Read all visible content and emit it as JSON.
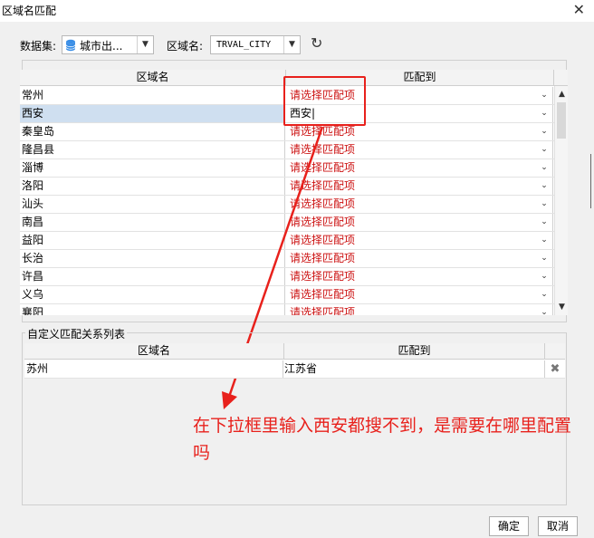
{
  "window": {
    "title": "区域名匹配",
    "close_glyph": "✕"
  },
  "toolbar": {
    "dataset_label": "数据集:",
    "dataset_value": "城市出...",
    "region_label": "区域名:",
    "region_value": "TRVAL_CITY",
    "refresh_glyph": "↻"
  },
  "grid": {
    "headers": [
      "区域名",
      "匹配到"
    ],
    "rows": [
      {
        "name": "常州",
        "match": "请选择匹配项"
      },
      {
        "name": "西安",
        "match": "西安|"
      },
      {
        "name": "秦皇岛",
        "match": "请选择匹配项"
      },
      {
        "name": "隆昌县",
        "match": "请选择匹配项"
      },
      {
        "name": "淄博",
        "match": "请选择匹配项"
      },
      {
        "name": "洛阳",
        "match": "请选择匹配项"
      },
      {
        "name": "汕头",
        "match": "请选择匹配项"
      },
      {
        "name": "南昌",
        "match": "请选择匹配项"
      },
      {
        "name": "益阳",
        "match": "请选择匹配项"
      },
      {
        "name": "长治",
        "match": "请选择匹配项"
      },
      {
        "name": "许昌",
        "match": "请选择匹配项"
      },
      {
        "name": "义乌",
        "match": "请选择匹配项"
      },
      {
        "name": "襄阳",
        "match": "请选择匹配项"
      }
    ],
    "selected_row": 1,
    "dropdown_glyph": "⌄"
  },
  "custom": {
    "label": "自定义匹配关系列表",
    "headers": [
      "区域名",
      "匹配到"
    ],
    "rows": [
      {
        "name": "苏州",
        "match": "江苏省"
      }
    ],
    "delete_glyph": "✖"
  },
  "annotation": {
    "text": "在下拉框里输入西安都搜不到，是需要在哪里配置吗",
    "color": "#e8211c"
  },
  "buttons": {
    "ok": "确定",
    "cancel": "取消"
  },
  "colors": {
    "placeholder_red": "#cc1111",
    "selected_row": "#cfdff0",
    "accent_db": "#3a8ee6"
  }
}
